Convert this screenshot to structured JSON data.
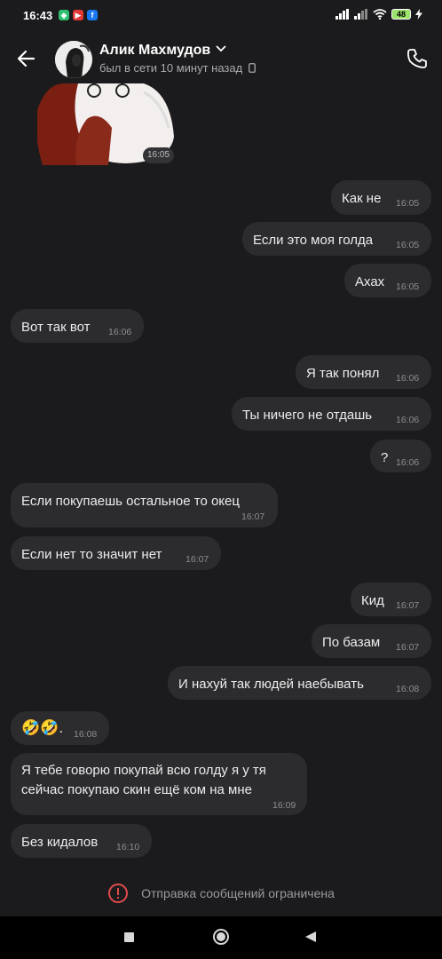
{
  "status_bar": {
    "time": "16:43",
    "battery": "48"
  },
  "header": {
    "contact_name": "Алик Махмудов",
    "contact_status": "был в сети 10 минут назад"
  },
  "sticker": {
    "time": "16:05"
  },
  "messages": [
    {
      "text": "Как не",
      "time": "16:05",
      "side": "out"
    },
    {
      "text": "Если это моя голда",
      "time": "16:05",
      "side": "out"
    },
    {
      "text": "Ахах",
      "time": "16:05",
      "side": "out"
    },
    {
      "text": "Вот так вот",
      "time": "16:06",
      "side": "in"
    },
    {
      "text": "Я так понял",
      "time": "16:06",
      "side": "out"
    },
    {
      "text": "Ты ничего не отдашь",
      "time": "16:06",
      "side": "out"
    },
    {
      "text": "?",
      "time": "16:06",
      "side": "out"
    },
    {
      "text": "Если покупаешь остальное то окец",
      "time": "16:07",
      "side": "in"
    },
    {
      "text": "Если нет то значит нет",
      "time": "16:07",
      "side": "in"
    },
    {
      "text": "Кид",
      "time": "16:07",
      "side": "out"
    },
    {
      "text": "По базам",
      "time": "16:07",
      "side": "out"
    },
    {
      "text": "И нахуй так людей наебывать",
      "time": "16:08",
      "side": "out"
    },
    {
      "text": "🤣🤣.",
      "time": "16:08",
      "side": "in"
    },
    {
      "text": "Я тебе говорю покупай всю голду я у тя сейчас покупаю скин ещё ком на мне",
      "time": "16:09",
      "side": "in"
    },
    {
      "text": "Без кидалов",
      "time": "16:10",
      "side": "in"
    }
  ],
  "footer": {
    "restricted_text": "Отправка сообщений ограничена"
  },
  "colors": {
    "background": "#1b1b1d",
    "bubble": "#2c2c2f",
    "alert_red": "#e04b4b"
  }
}
